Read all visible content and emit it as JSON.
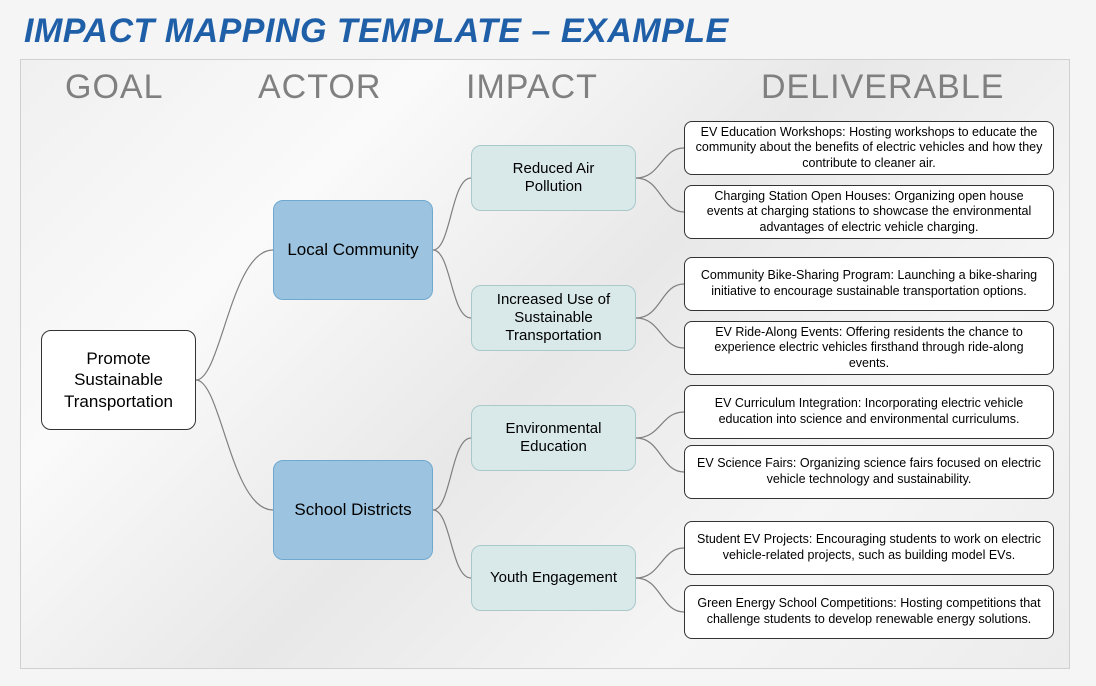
{
  "title": "IMPACT MAPPING TEMPLATE – EXAMPLE",
  "headers": {
    "goal": "GOAL",
    "actor": "ACTOR",
    "impact": "IMPACT",
    "deliverable": "DELIVERABLE"
  },
  "goal": "Promote Sustainable Transportation",
  "actors": {
    "a1": "Local Community",
    "a2": "School Districts"
  },
  "impacts": {
    "i1": "Reduced Air Pollution",
    "i2": "Increased Use of Sustainable Transportation",
    "i3": "Environmental Education",
    "i4": "Youth Engagement"
  },
  "deliverables": {
    "d1": "EV Education Workshops: Hosting workshops to educate the community about the benefits of electric vehicles and how they contribute to cleaner air.",
    "d2": "Charging Station Open Houses: Organizing open house events at charging stations to showcase the environmental advantages of electric vehicle charging.",
    "d3": "Community Bike-Sharing Program: Launching a bike-sharing initiative to encourage sustainable transportation options.",
    "d4": "EV Ride-Along Events: Offering residents the chance to experience electric vehicles firsthand through ride-along events.",
    "d5": "EV Curriculum Integration: Incorporating electric vehicle education into science and environmental curriculums.",
    "d6": "EV Science Fairs: Organizing science fairs focused on electric vehicle technology and sustainability.",
    "d7": "Student EV Projects: Encouraging students to work on electric vehicle-related projects, such as building model EVs.",
    "d8": "Green Energy School Competitions: Hosting competitions that challenge students to develop renewable energy solutions."
  }
}
